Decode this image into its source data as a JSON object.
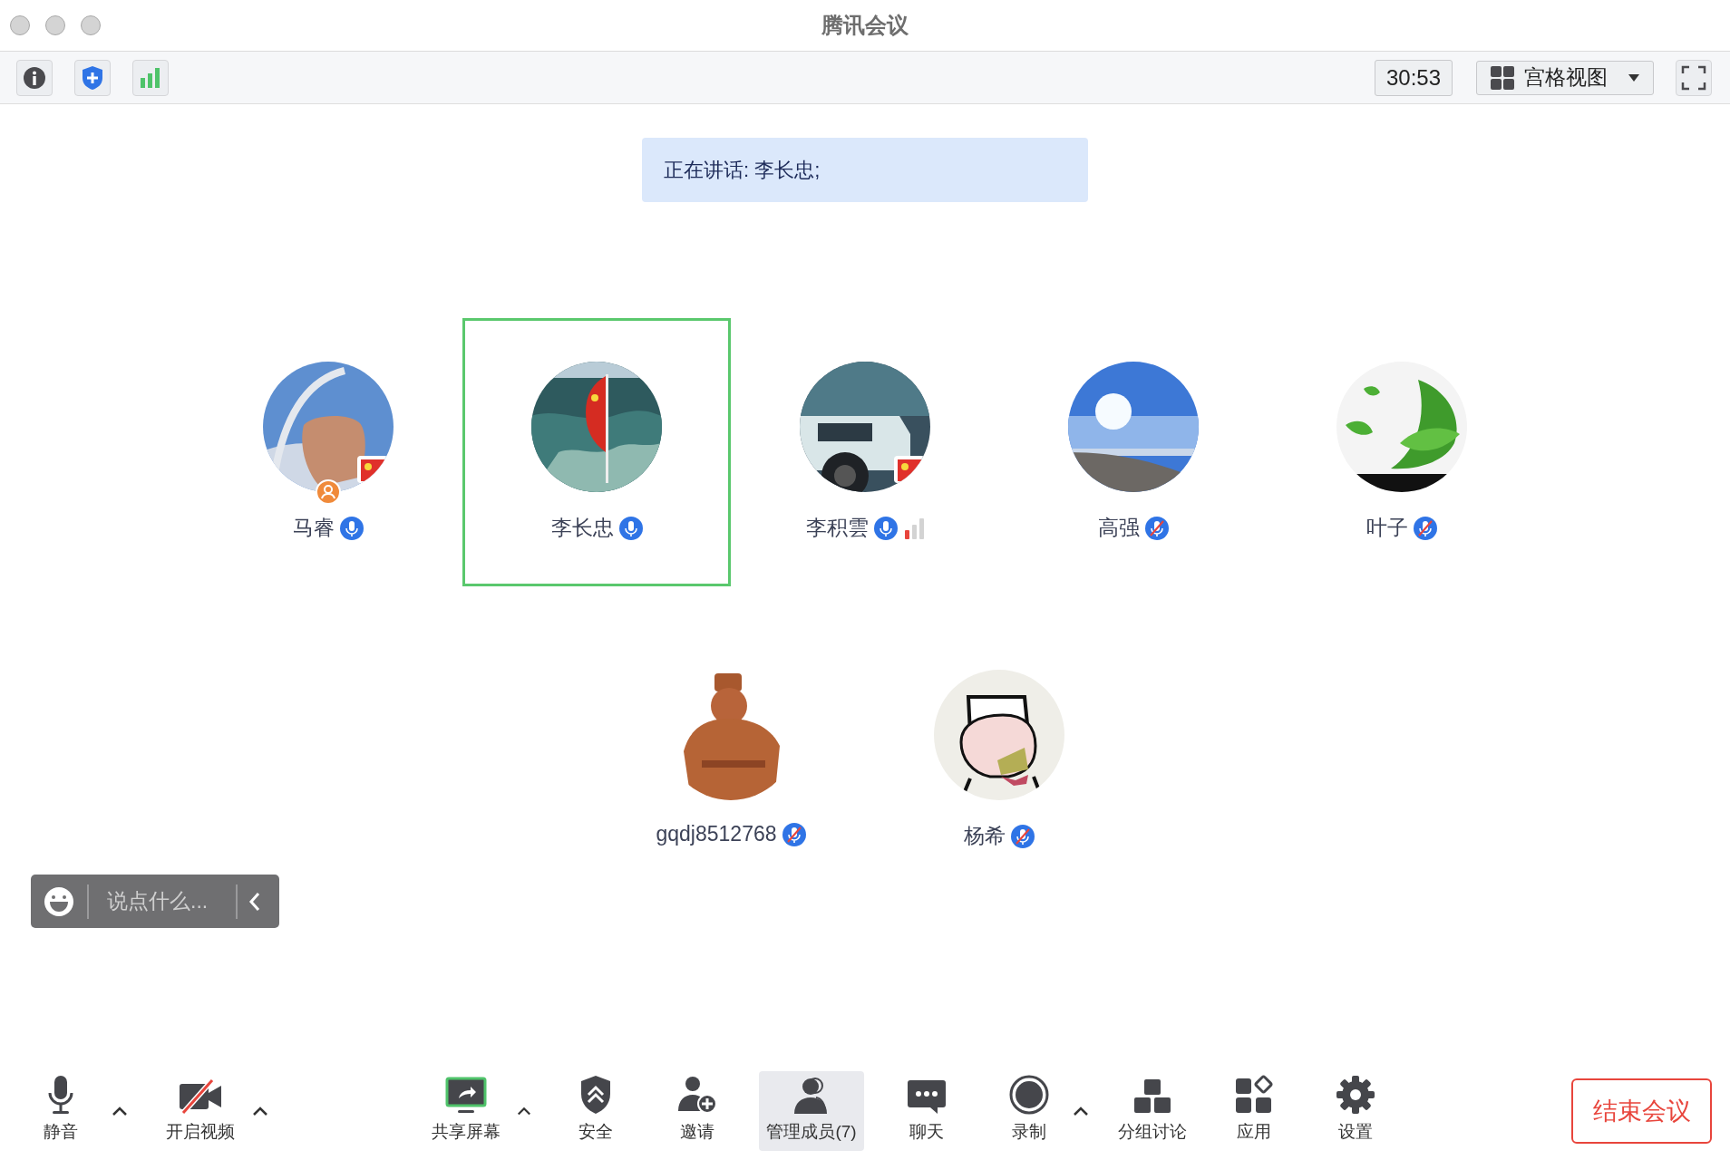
{
  "window": {
    "title": "腾讯会议"
  },
  "top_toolbar": {
    "timer": "30:53",
    "view_menu": {
      "label": "宫格视图"
    }
  },
  "speaking_banner": "正在讲话: 李长忠;",
  "participants": [
    {
      "name": "马睿",
      "mic_muted": false,
      "host": true,
      "weak_signal": false,
      "selected": false
    },
    {
      "name": "李长忠",
      "mic_muted": false,
      "host": false,
      "weak_signal": false,
      "selected": true
    },
    {
      "name": "李积雲",
      "mic_muted": false,
      "host": false,
      "weak_signal": true,
      "selected": false
    },
    {
      "name": "高强",
      "mic_muted": true,
      "host": false,
      "weak_signal": false,
      "selected": false
    },
    {
      "name": "叶子",
      "mic_muted": true,
      "host": false,
      "weak_signal": false,
      "selected": false
    },
    {
      "name": "gqdj8512768",
      "mic_muted": true,
      "host": false,
      "weak_signal": false,
      "selected": false
    },
    {
      "name": "杨希",
      "mic_muted": true,
      "host": false,
      "weak_signal": false,
      "selected": false
    }
  ],
  "chat_input": {
    "placeholder": "说点什么..."
  },
  "bottom_toolbar": [
    {
      "kind": "button",
      "label": "静音",
      "active": false
    },
    {
      "kind": "caret"
    },
    {
      "kind": "button",
      "label": "开启视频",
      "active": false
    },
    {
      "kind": "caret"
    },
    {
      "kind": "button",
      "label": "共享屏幕",
      "active": false
    },
    {
      "kind": "caret"
    },
    {
      "kind": "button",
      "label": "安全",
      "active": false
    },
    {
      "kind": "button",
      "label": "邀请",
      "active": false
    },
    {
      "kind": "button",
      "label": "管理成员(7)",
      "active": true
    },
    {
      "kind": "button",
      "label": "聊天",
      "active": false
    },
    {
      "kind": "button",
      "label": "录制",
      "active": false
    },
    {
      "kind": "caret"
    },
    {
      "kind": "button",
      "label": "分组讨论",
      "active": false
    },
    {
      "kind": "button",
      "label": "应用",
      "active": false
    },
    {
      "kind": "button",
      "label": "设置",
      "active": false
    }
  ],
  "end_button": "结束会议"
}
